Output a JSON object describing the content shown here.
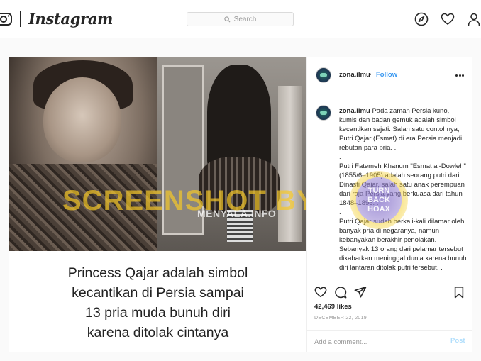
{
  "app": {
    "logo_text": "Instagram",
    "search_placeholder": "Search",
    "nav_icons": [
      "explore-icon",
      "heart-icon",
      "profile-icon"
    ]
  },
  "post": {
    "username": "zona.ilmu",
    "follow_label": "Follow",
    "separator": "•",
    "image": {
      "caption_lines": [
        "Princess Qajar adalah simbol",
        "kecantikan di Persia sampai",
        "13 pria muda bunuh diri",
        "karena ditolak cintanya"
      ],
      "watermark_photo": "MENYALA.INFO",
      "watermark_overlay": "SCREENSHOT BY",
      "stamp_text": [
        "TURN",
        "BACK",
        "HOAX"
      ]
    },
    "caption": {
      "username": "zona.ilmu",
      "paragraph_1": "Pada zaman Persia kuno, kumis dan badan gemuk adalah simbol kecantikan sejati. Salah satu contohnya, Putri Qajar (Esmat) di era Persia menjadi rebutan para pria. .",
      "dot_1": ".",
      "paragraph_2": "Putri Fatemeh Khanum \"Esmat al-Dowleh\" (1855/6–1905) adalah seorang putri dari Dinasti Qajar, salah satu anak perempuan dari raja Persia yang berkuasa dari tahun 1848–1896. .",
      "dot_2": ".",
      "paragraph_3": "Putri Qajar sudah berkali-kali dilamar oleh banyak pria di negaranya, namun kebanyakan berakhir penolakan. Sebanyak 13 orang dari pelamar tersebut dikabarkan meninggal dunia karena bunuh diri lantaran ditolak putri tersebut. ."
    },
    "likes": "42,469 likes",
    "date": "DECEMBER 22, 2019",
    "add_comment_placeholder": "Add a comment...",
    "post_button": "Post"
  },
  "colors": {
    "link_blue": "#3897f0",
    "post_disabled": "#b2dffc",
    "border": "#dbdbdb",
    "background": "#fafafa"
  }
}
